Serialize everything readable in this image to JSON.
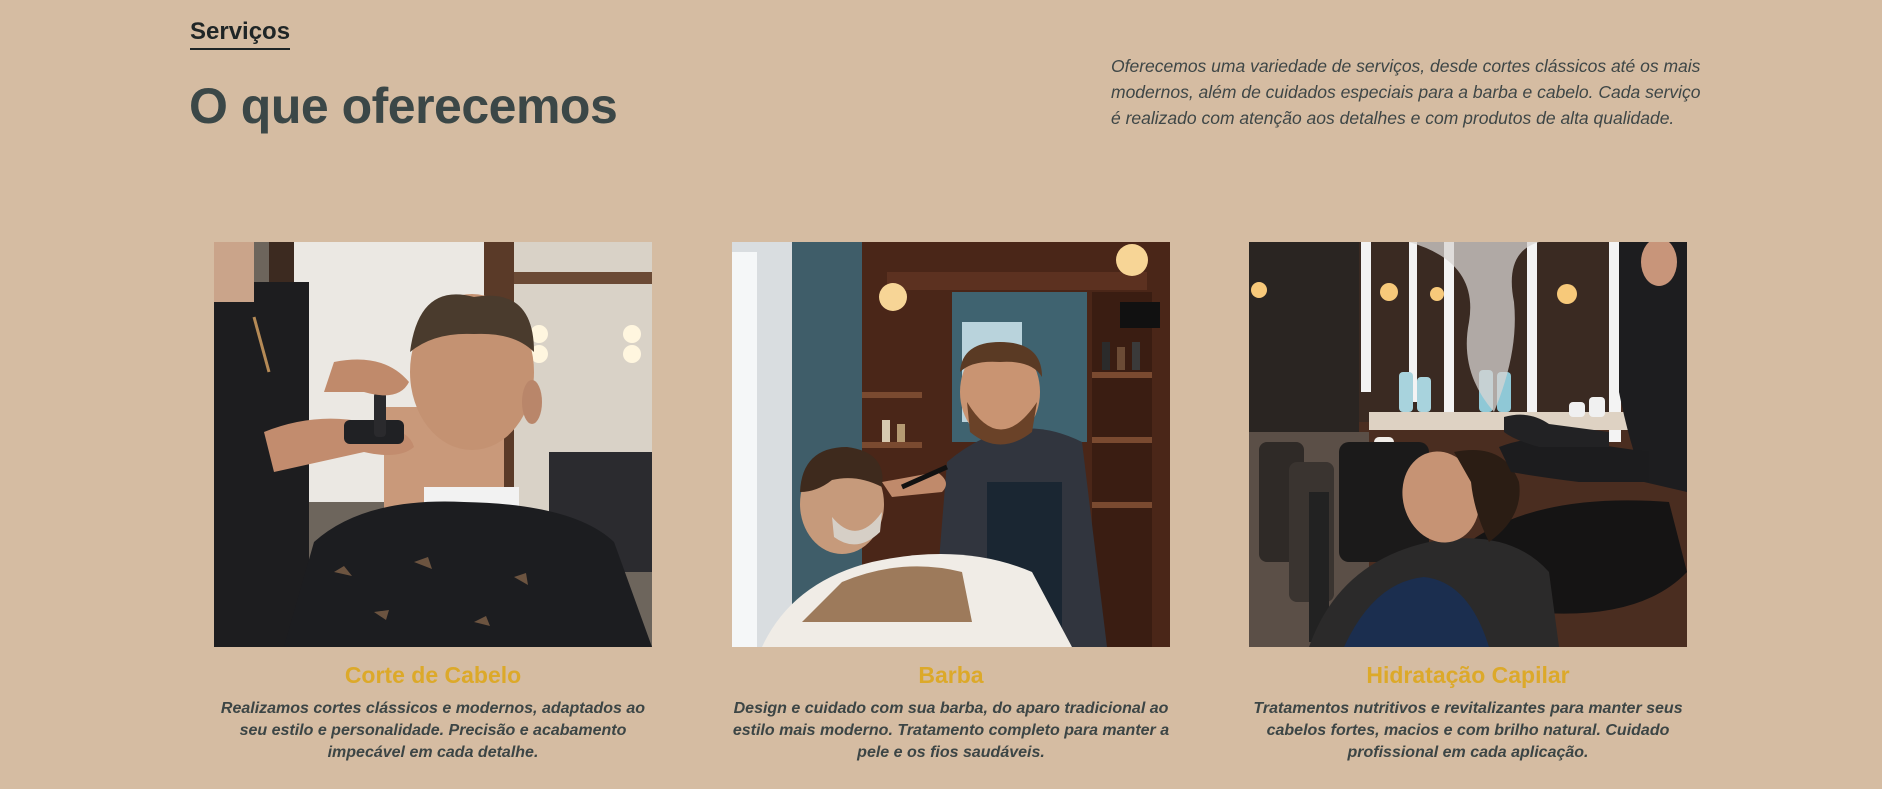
{
  "header": {
    "section_label": "Serviços",
    "title": "O que oferecemos",
    "intro": "Oferecemos uma variedade de serviços, desde cortes clássicos até os mais modernos, além de cuidados especiais para a barba e cabelo. Cada serviço é realizado com atenção aos detalhes e com produtos de alta qualidade."
  },
  "services": [
    {
      "title": "Corte de Cabelo",
      "description": "Realizamos cortes clássicos e modernos, adaptados ao seu estilo e personalidade. Precisão e acabamento impecável em cada detalhe.",
      "image": "haircut-photo"
    },
    {
      "title": "Barba",
      "description": "Design e cuidado com sua barba, do aparo tradicional ao estilo mais moderno. Tratamento completo para manter a pele e os fios saudáveis.",
      "image": "beard-trim-photo"
    },
    {
      "title": "Hidratação Capilar",
      "description": "Tratamentos nutritivos e revitalizantes para manter seus cabelos fortes, macios e com brilho natural. Cuidado profissional em cada aplicação.",
      "image": "hair-hydration-photo"
    }
  ],
  "colors": {
    "background": "#d5bca2",
    "heading": "#3b4747",
    "accent": "#dca92a",
    "text": "#3c4545"
  }
}
